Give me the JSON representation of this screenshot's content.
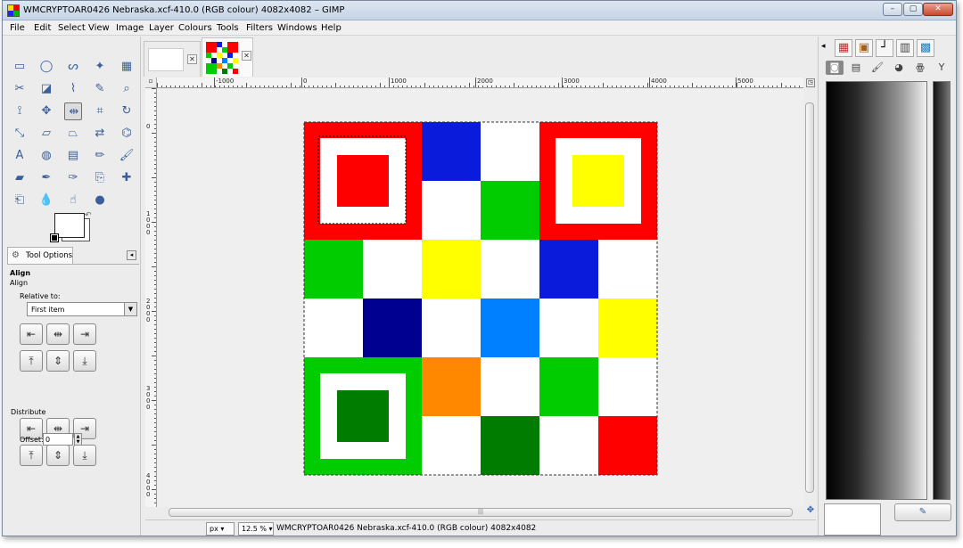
{
  "window": {
    "title": "WMCRYPTOAR0426 Nebraska.xcf-410.0 (RGB colour) 4082x4082 – GIMP",
    "controls": {
      "minimize": "–",
      "maximize": "▢",
      "close": "✕"
    }
  },
  "menubar": {
    "items": [
      "File",
      "Edit",
      "Select",
      "View",
      "Image",
      "Layer",
      "Colours",
      "Tools",
      "Filters",
      "Windows",
      "Help"
    ]
  },
  "toolbox": {
    "tools": [
      {
        "name": "rect-select-icon",
        "glyph": "▭"
      },
      {
        "name": "ellipse-select-icon",
        "glyph": "◯"
      },
      {
        "name": "free-select-icon",
        "glyph": "ᔕ"
      },
      {
        "name": "fuzzy-select-icon",
        "glyph": "✦"
      },
      {
        "name": "select-by-color-icon",
        "glyph": "▦"
      },
      {
        "name": "scissors-select-icon",
        "glyph": "✂"
      },
      {
        "name": "foreground-select-icon",
        "glyph": "◪"
      },
      {
        "name": "paths-icon",
        "glyph": "⌇"
      },
      {
        "name": "color-picker-icon",
        "glyph": "✎"
      },
      {
        "name": "zoom-icon",
        "glyph": "⌕"
      },
      {
        "name": "measure-icon",
        "glyph": "⟟"
      },
      {
        "name": "move-icon",
        "glyph": "✥"
      },
      {
        "name": "align-icon",
        "glyph": "⇹"
      },
      {
        "name": "crop-icon",
        "glyph": "⌗"
      },
      {
        "name": "rotate-icon",
        "glyph": "↻"
      },
      {
        "name": "scale-icon",
        "glyph": "⤡"
      },
      {
        "name": "shear-icon",
        "glyph": "▱"
      },
      {
        "name": "perspective-icon",
        "glyph": "⏢"
      },
      {
        "name": "flip-icon",
        "glyph": "⇄"
      },
      {
        "name": "cage-transform-icon",
        "glyph": "⌬"
      },
      {
        "name": "text-icon",
        "glyph": "A"
      },
      {
        "name": "bucket-fill-icon",
        "glyph": "◍"
      },
      {
        "name": "blend-icon",
        "glyph": "▤"
      },
      {
        "name": "pencil-icon",
        "glyph": "✏"
      },
      {
        "name": "paintbrush-icon",
        "glyph": "🖌"
      },
      {
        "name": "eraser-icon",
        "glyph": "▰"
      },
      {
        "name": "airbrush-icon",
        "glyph": "✒"
      },
      {
        "name": "ink-icon",
        "glyph": "✑"
      },
      {
        "name": "clone-icon",
        "glyph": "⎘"
      },
      {
        "name": "heal-icon",
        "glyph": "✚"
      },
      {
        "name": "perspective-clone-icon",
        "glyph": "⎗"
      },
      {
        "name": "blur-sharpen-icon",
        "glyph": "💧"
      },
      {
        "name": "smudge-icon",
        "glyph": "☝"
      },
      {
        "name": "dodge-burn-icon",
        "glyph": "●"
      }
    ],
    "active_tool": "align-icon",
    "tool_options_tab": "Tool Options",
    "tool_options": {
      "heading": "Align",
      "subheading": "Align",
      "relative_label": "Relative to:",
      "relative_value": "First item",
      "distribute_label": "Distribute",
      "offset_label": "Offset:",
      "offset_value": "0"
    },
    "align_buttons": [
      {
        "name": "align-left-edge-icon",
        "glyph": "⇤"
      },
      {
        "name": "align-center-vertical-icon",
        "glyph": "⇹"
      },
      {
        "name": "align-right-edge-icon",
        "glyph": "⇥"
      },
      {
        "name": "align-top-edge-icon",
        "glyph": "⤒"
      },
      {
        "name": "align-middle-horizontal-icon",
        "glyph": "⇕"
      },
      {
        "name": "align-bottom-edge-icon",
        "glyph": "⤓"
      }
    ],
    "distribute_buttons": [
      {
        "name": "distribute-left-edges-icon",
        "glyph": "⇤"
      },
      {
        "name": "distribute-centers-horizontal-icon",
        "glyph": "⇹"
      },
      {
        "name": "distribute-right-edges-icon",
        "glyph": "⇥"
      },
      {
        "name": "distribute-top-edges-icon",
        "glyph": "⤒"
      },
      {
        "name": "distribute-centers-vertical-icon",
        "glyph": "⇕"
      },
      {
        "name": "distribute-bottom-edges-icon",
        "glyph": "⤓"
      }
    ],
    "bottom_icons": [
      {
        "name": "save-options-icon",
        "glyph": "💾",
        "color": "#2a5ea8"
      },
      {
        "name": "restore-options-icon",
        "glyph": "⬚",
        "color": "#555555"
      },
      {
        "name": "delete-options-icon",
        "glyph": "🗑",
        "color": "#777777"
      },
      {
        "name": "reset-options-icon",
        "glyph": "↺",
        "color": "#c89a20"
      }
    ]
  },
  "image_tabs": [
    {
      "name": "image-tab-blank",
      "close": "✕"
    },
    {
      "name": "image-tab-nebraska",
      "close": "✕"
    }
  ],
  "rulers": {
    "horizontal_labels": [
      {
        "text": "-1000",
        "pos": 78
      },
      {
        "text": "0",
        "pos": 176
      },
      {
        "text": "1000",
        "pos": 274
      },
      {
        "text": "2000",
        "pos": 371
      },
      {
        "text": "3000",
        "pos": 468
      },
      {
        "text": "4000",
        "pos": 566
      },
      {
        "text": "5000",
        "pos": 663
      }
    ],
    "vertical_labels": [
      "0",
      "1000",
      "2000",
      "3000",
      "4000"
    ]
  },
  "artwork": {
    "colors": {
      "red": "#ff0000",
      "blue": "#0b1bdb",
      "green": "#00cc00",
      "dark_green": "#007d00",
      "yellow": "#ffff00",
      "navy": "#000090",
      "sky": "#0080ff",
      "orange": "#ff8800",
      "white": "#ffffff"
    },
    "grid": [
      [
        "finder:red:red",
        "finder:red:red",
        "blue",
        "white",
        "finder:red:yellow",
        "finder:red:yellow"
      ],
      [
        "finder:red:red",
        "finder:red:red",
        "white",
        "green",
        "finder:red:yellow",
        "finder:red:yellow"
      ],
      [
        "green",
        "white",
        "yellow",
        "white",
        "blue",
        "white"
      ],
      [
        "white",
        "navy",
        "white",
        "sky",
        "white",
        "yellow"
      ],
      [
        "finder:green:dark_green",
        "finder:green:dark_green",
        "orange",
        "white",
        "green",
        "white"
      ],
      [
        "finder:green:dark_green",
        "finder:green:dark_green",
        "white",
        "dark_green",
        "white",
        "red"
      ]
    ]
  },
  "statusbar": {
    "unit": "px",
    "zoom": "12.5 %",
    "text": "WMCRYPTOAR0426 Nebraska.xcf-410.0 (RGB colour) 4082x4082"
  },
  "right_dock": {
    "tabs": [
      {
        "name": "patterns-tab-icon",
        "glyph": "▦",
        "color": "#c03030"
      },
      {
        "name": "brushes-tab-icon",
        "glyph": "▣",
        "color": "#a06020"
      },
      {
        "name": "paths-tab-icon",
        "glyph": "┘",
        "color": "#000000"
      },
      {
        "name": "gradients-tab-icon",
        "glyph": "▥",
        "color": "#444444"
      },
      {
        "name": "palettes-tab-icon",
        "glyph": "▩",
        "color": "#2080c0"
      }
    ],
    "subtabs": [
      {
        "name": "layers-subtab-icon",
        "glyph": "◙"
      },
      {
        "name": "channels-subtab-icon",
        "glyph": "▤"
      },
      {
        "name": "brush-subtab-icon",
        "glyph": "🖌"
      },
      {
        "name": "color-subtab-icon",
        "glyph": "◕"
      },
      {
        "name": "fonts-subtab-icon",
        "glyph": "ꙮ"
      },
      {
        "name": "history-subtab-icon",
        "glyph": "Y"
      }
    ]
  }
}
